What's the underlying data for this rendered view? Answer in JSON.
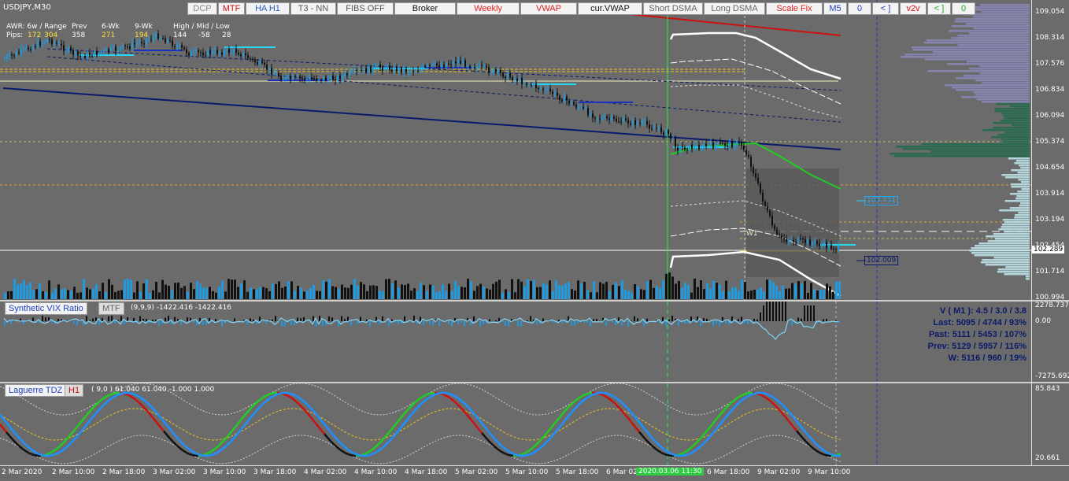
{
  "symbol_title": "USDJPY,M30",
  "toolbar": [
    {
      "label": "DCP",
      "color": "#888888"
    },
    {
      "label": "MTF",
      "color": "#d01010"
    },
    {
      "label": "HA H1",
      "color": "#2060d0"
    },
    {
      "label": "T3 - NN",
      "color": "#555555"
    },
    {
      "label": "FIBS OFF",
      "color": "#555555"
    },
    {
      "label": "Broker",
      "color": "#111111"
    },
    {
      "label": "Weekly",
      "color": "#e02020"
    },
    {
      "label": "VWAP",
      "color": "#e02020"
    },
    {
      "label": "cur.VWAP",
      "color": "#111111"
    },
    {
      "label": "Short DSMA",
      "color": "#666666"
    },
    {
      "label": "Long DSMA",
      "color": "#666666"
    },
    {
      "label": "Scale Fix",
      "color": "#e02020"
    },
    {
      "label": "M5",
      "color": "#2040c0"
    },
    {
      "label": "0",
      "color": "#2040c0"
    },
    {
      "label": "< ]",
      "color": "#2040c0"
    },
    {
      "label": "v2v",
      "color": "#d01010"
    },
    {
      "label": "< ]",
      "color": "#20a020"
    },
    {
      "label": "0",
      "color": "#20a020"
    }
  ],
  "stats": {
    "awr": "AWR: 6w / Range",
    "prev": "Prev",
    "six_wk": "6-Wk",
    "nine_wk": "9-Wk",
    "hml": "High / Mid / Low",
    "pips": "Pips:",
    "v172": "172",
    "v304": "304",
    "v358": "358",
    "v271": "271",
    "v194": "194",
    "v144": "144",
    "v58": "-58",
    "v28": "28"
  },
  "price_axis": [
    "109.054",
    "108.314",
    "107.576",
    "106.834",
    "106.094",
    "105.374",
    "104.654",
    "103.914",
    "103.194",
    "102.454",
    "101.714",
    "100.994"
  ],
  "current_price": "102.289",
  "level_labels": {
    "upper": "103.731",
    "lower": "102.009",
    "w1": "W1"
  },
  "vix": {
    "name": "Synthetic VIX Ratio",
    "tf": "MTF",
    "params": "(9,9,9) -1422.416 -1422.416",
    "axis_top": "2278.737",
    "axis_zero": "0.00",
    "axis_bottom": "-7275.692",
    "stats": [
      "V ( M1 ): 4.5 / 3.0 / 3.8",
      "Last: 5095 / 4744 / 93%",
      "Past: 5111 / 5453 / 107%",
      "Prev: 5129 / 5957 / 116%",
      "W: 5116 / 960 / 19%"
    ]
  },
  "laguerre": {
    "name": "Laguerre TDZ",
    "tf": "H1",
    "params": "( 9,0 ) 61.040 61.040 -1.000 1.000",
    "axis_top": "85.843",
    "axis_bottom": "20.661"
  },
  "time_axis": [
    "2 Mar 2020",
    "2 Mar 10:00",
    "2 Mar 18:00",
    "3 Mar 02:00",
    "3 Mar 10:00",
    "3 Mar 18:00",
    "4 Mar 02:00",
    "4 Mar 10:00",
    "4 Mar 18:00",
    "5 Mar 02:00",
    "5 Mar 10:00",
    "5 Mar 18:00",
    "6 Mar 02",
    "6 Mar 18:00",
    "9 Mar 02:00",
    "9 Mar 10:00"
  ],
  "time_highlight": "2020.03.06 11:30",
  "colors": {
    "background": "#6b6b6b",
    "bull_candle": "#1e9be0",
    "bear_candle": "#111111",
    "green_line": "#22cc22",
    "red_line": "#cc1111",
    "navy_line": "#0a1a6a",
    "yellow_dashed": "#e8c020"
  }
}
